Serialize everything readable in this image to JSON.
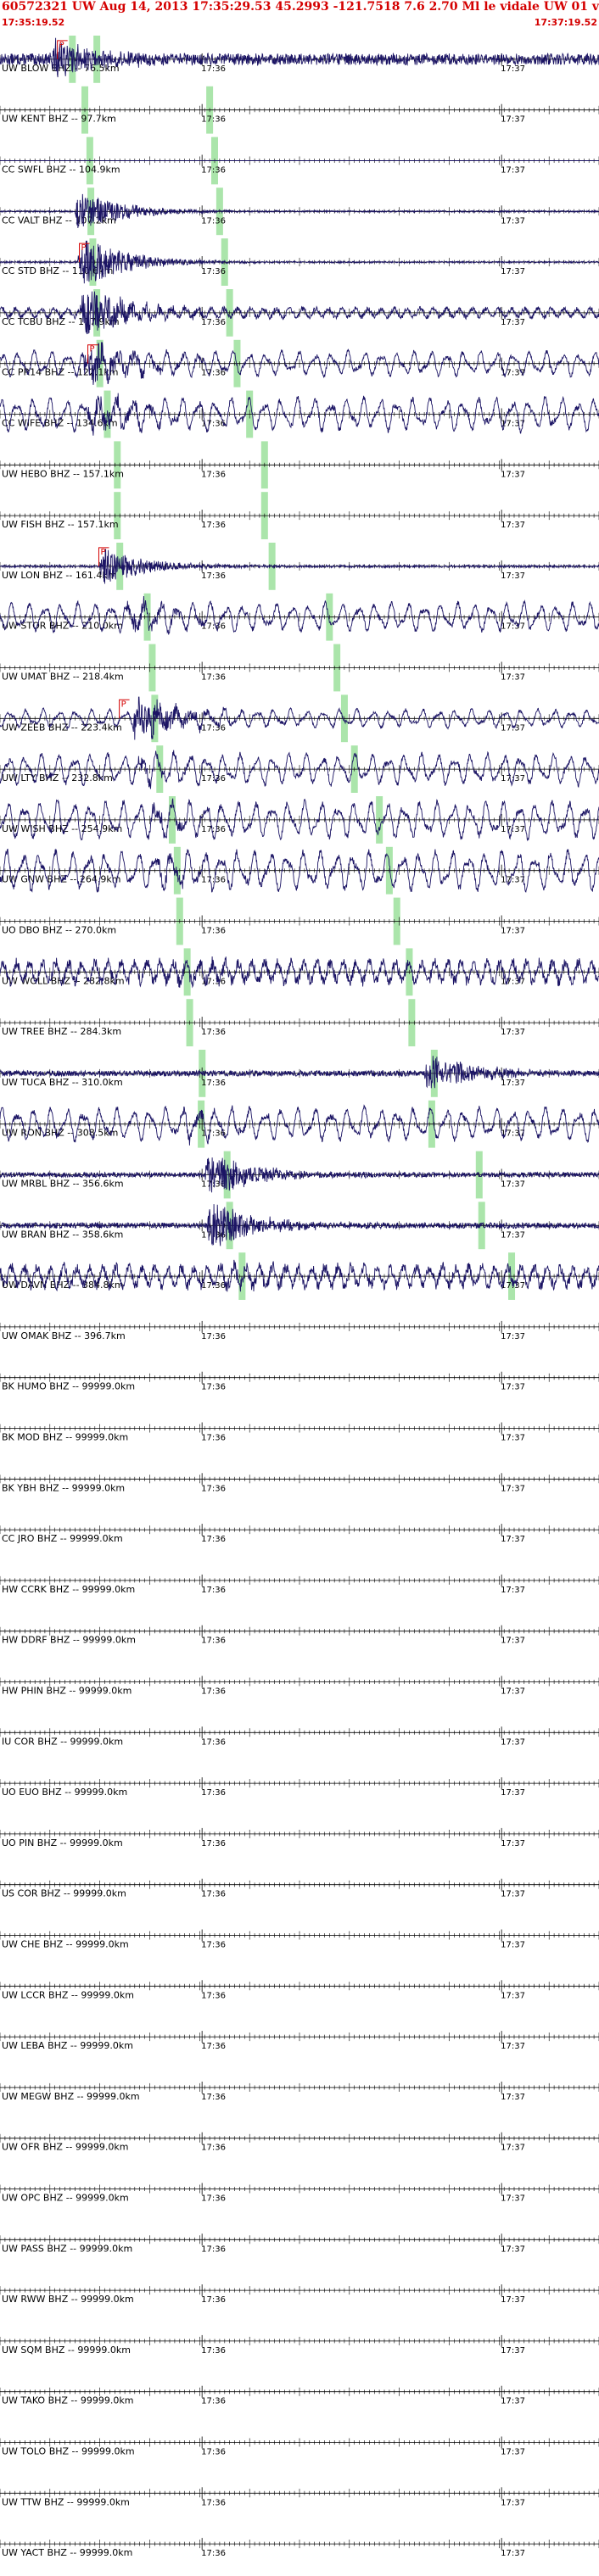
{
  "header": {
    "title": "60572321 UW Aug 14, 2013 17:35:29.53   45.2993 -121.7518  7.6 2.70 Ml le vidale UW 01  v",
    "start_time": "17:35:19.52",
    "end_time": "17:37:19.52"
  },
  "chart_data": {
    "type": "seismogram",
    "title": "60572321 UW Aug 14, 2013 17:35:29.53   45.2993 -121.7518  7.6 2.70 Ml le vidale UW 01  v",
    "time_window": {
      "start": "17:35:19.52",
      "end": "17:37:19.52",
      "duration_s": 120
    },
    "minute_marks": [
      {
        "label": "17:36",
        "t_s": 40.48
      },
      {
        "label": "17:37",
        "t_s": 100.48
      }
    ],
    "tick_interval_s": 1,
    "picks": [
      {
        "label": "P",
        "color": "#d40000"
      }
    ],
    "traces": [
      {
        "label": "UW BLOW BHZ -- 76.5km",
        "amp": 0.7,
        "burst_t": 10.0,
        "burst_amp": 0.55,
        "noise": "hf",
        "pick_t": 11.5,
        "p_t": 14.5,
        "s_t": 19.4
      },
      {
        "label": "UW KENT BHZ -- 97.7km",
        "amp": 0.0,
        "burst_t": 13.5,
        "burst_amp": 0.0,
        "noise": "flat",
        "p_t": 17.0,
        "s_t": 42.0
      },
      {
        "label": "CC SWFL BHZ -- 104.9km",
        "amp": 0.05,
        "burst_t": 14.8,
        "burst_amp": 0.0,
        "noise": "flat",
        "p_t": 18.0,
        "s_t": 43.0
      },
      {
        "label": "CC VALT BHZ -- 107.2km",
        "amp": 0.1,
        "burst_t": 15.0,
        "burst_amp": 0.6,
        "noise": "hf",
        "p_t": 18.2,
        "s_t": 44.0
      },
      {
        "label": "CC STD BHZ -- 110.6km",
        "amp": 0.1,
        "burst_t": 15.5,
        "burst_amp": 0.8,
        "noise": "hf",
        "pick_t": 15.9,
        "p_t": 18.6,
        "s_t": 45.0
      },
      {
        "label": "CC TCBU BHZ -- 117.9km",
        "amp": 0.4,
        "burst_t": 16.0,
        "burst_amp": 0.7,
        "noise": "mixed",
        "p_t": 19.4,
        "s_t": 46.0
      },
      {
        "label": "CC PR14 BHZ -- 122.1km",
        "amp": 0.6,
        "burst_t": 16.5,
        "burst_amp": 0.6,
        "noise": "lf",
        "pick_t": 17.6,
        "p_t": 20.0,
        "s_t": 47.5
      },
      {
        "label": "CC WIFE BHZ -- 134.6km",
        "amp": 0.8,
        "burst_t": 17.5,
        "burst_amp": 0.4,
        "noise": "lf",
        "p_t": 21.5,
        "s_t": 50.0
      },
      {
        "label": "UW HEBO BHZ -- 157.1km",
        "amp": 0.0,
        "burst_t": 19.5,
        "burst_amp": 0.0,
        "noise": "flat",
        "p_t": 23.5,
        "s_t": 53.0
      },
      {
        "label": "UW FISH BHZ -- 157.1km",
        "amp": 0.0,
        "burst_t": 19.5,
        "burst_amp": 0.0,
        "noise": "flat",
        "p_t": 23.5,
        "s_t": 53.0
      },
      {
        "label": "UW LON BHZ -- 161.4km",
        "amp": 0.15,
        "burst_t": 20.0,
        "burst_amp": 0.55,
        "noise": "hf",
        "pick_t": 19.8,
        "p_t": 24.0,
        "s_t": 54.5
      },
      {
        "label": "UW STOR BHZ -- 210.0km",
        "amp": 0.7,
        "burst_t": 25.0,
        "burst_amp": 0.3,
        "noise": "lf",
        "p_t": 29.5,
        "s_t": 66.0
      },
      {
        "label": "UW UMAT BHZ -- 218.4km",
        "amp": 0.0,
        "burst_t": 26.0,
        "burst_amp": 0.0,
        "noise": "flat",
        "p_t": 30.5,
        "s_t": 67.5
      },
      {
        "label": "UW ZEEB BHZ -- 223.4km",
        "amp": 0.45,
        "burst_t": 26.5,
        "burst_amp": 0.6,
        "noise": "lf",
        "pick_t": 23.9,
        "p_t": 31.0,
        "s_t": 69.0
      },
      {
        "label": "UW LTY BHZ -- 232.8km",
        "amp": 0.75,
        "burst_t": 27.5,
        "burst_amp": 0.2,
        "noise": "lf",
        "p_t": 32.0,
        "s_t": 71.0
      },
      {
        "label": "UW WISH BHZ -- 254.9km",
        "amp": 0.9,
        "burst_t": 30.0,
        "burst_amp": 0.2,
        "noise": "lf",
        "p_t": 34.5,
        "s_t": 76.0
      },
      {
        "label": "UW GNW BHZ -- 264.9km",
        "amp": 0.95,
        "burst_t": 31.0,
        "burst_amp": 0.2,
        "noise": "lf",
        "p_t": 35.5,
        "s_t": 78.0
      },
      {
        "label": "UO DBO BHZ -- 270.0km",
        "amp": 0.0,
        "burst_t": 31.5,
        "burst_amp": 0.0,
        "noise": "flat",
        "p_t": 36.0,
        "s_t": 79.5
      },
      {
        "label": "UW WOLL BHZ -- 282.8km",
        "amp": 0.9,
        "burst_t": 33.0,
        "burst_amp": 0.2,
        "noise": "mixed",
        "p_t": 37.5,
        "s_t": 82.0
      },
      {
        "label": "UW TREE BHZ -- 284.3km",
        "amp": 0.0,
        "burst_t": 33.0,
        "burst_amp": 0.0,
        "noise": "flat",
        "p_t": 38.0,
        "s_t": 82.5
      },
      {
        "label": "UW TUCA BHZ -- 310.0km",
        "amp": 0.35,
        "burst_t": 85.0,
        "burst_amp": 0.6,
        "noise": "hf",
        "p_t": 40.5,
        "s_t": 87.0
      },
      {
        "label": "UW RON BHZ -- 308.5km",
        "amp": 0.8,
        "burst_t": 36.0,
        "burst_amp": 0.2,
        "noise": "lf",
        "p_t": 40.3,
        "s_t": 86.5
      },
      {
        "label": "UW MRBL BHZ -- 356.6km",
        "amp": 0.3,
        "burst_t": 41.0,
        "burst_amp": 0.7,
        "noise": "hf",
        "p_t": 45.5,
        "s_t": 96.0
      },
      {
        "label": "UW BRAN BHZ -- 358.6km",
        "amp": 0.35,
        "burst_t": 41.5,
        "burst_amp": 0.7,
        "noise": "hf",
        "p_t": 46.0,
        "s_t": 96.5
      },
      {
        "label": "UW DAVN BHZ -- 384.8km",
        "amp": 0.9,
        "burst_t": 44.0,
        "burst_amp": 0.2,
        "noise": "mixed",
        "p_t": 48.5,
        "s_t": 102.5
      },
      {
        "label": "UW OMAK BHZ -- 396.7km",
        "amp": 0.0,
        "burst_t": 45.0,
        "burst_amp": 0.0,
        "noise": "flat"
      },
      {
        "label": "BK HUMO BHZ -- 99999.0km",
        "amp": 0.0,
        "noise": "flat"
      },
      {
        "label": "BK MOD BHZ -- 99999.0km",
        "amp": 0.0,
        "noise": "flat"
      },
      {
        "label": "BK YBH BHZ -- 99999.0km",
        "amp": 0.0,
        "noise": "flat"
      },
      {
        "label": "CC JRO BHZ -- 99999.0km",
        "amp": 0.0,
        "noise": "flat"
      },
      {
        "label": "HW CCRK BHZ -- 99999.0km",
        "amp": 0.0,
        "noise": "flat"
      },
      {
        "label": "HW DDRF BHZ -- 99999.0km",
        "amp": 0.0,
        "noise": "flat"
      },
      {
        "label": "HW PHIN BHZ -- 99999.0km",
        "amp": 0.0,
        "noise": "flat"
      },
      {
        "label": "IU COR BHZ -- 99999.0km",
        "amp": 0.0,
        "noise": "flat"
      },
      {
        "label": "UO EUO BHZ -- 99999.0km",
        "amp": 0.0,
        "noise": "flat"
      },
      {
        "label": "UO PIN BHZ -- 99999.0km",
        "amp": 0.0,
        "noise": "flat"
      },
      {
        "label": "US COR BHZ -- 99999.0km",
        "amp": 0.0,
        "noise": "flat"
      },
      {
        "label": "UW CHE BHZ -- 99999.0km",
        "amp": 0.0,
        "noise": "flat"
      },
      {
        "label": "UW LCCR BHZ -- 99999.0km",
        "amp": 0.0,
        "noise": "flat"
      },
      {
        "label": "UW LEBA BHZ -- 99999.0km",
        "amp": 0.0,
        "noise": "flat"
      },
      {
        "label": "UW MEGW BHZ -- 99999.0km",
        "amp": 0.0,
        "noise": "flat"
      },
      {
        "label": "UW OFR BHZ -- 99999.0km",
        "amp": 0.0,
        "noise": "flat"
      },
      {
        "label": "UW OPC BHZ -- 99999.0km",
        "amp": 0.0,
        "noise": "flat"
      },
      {
        "label": "UW PASS BHZ -- 99999.0km",
        "amp": 0.0,
        "noise": "flat"
      },
      {
        "label": "UW RWW BHZ -- 99999.0km",
        "amp": 0.0,
        "noise": "flat"
      },
      {
        "label": "UW SQM BHZ -- 99999.0km",
        "amp": 0.0,
        "noise": "flat"
      },
      {
        "label": "UW TAKO BHZ -- 99999.0km",
        "amp": 0.0,
        "noise": "flat"
      },
      {
        "label": "UW TOLO BHZ -- 99999.0km",
        "amp": 0.0,
        "noise": "flat"
      },
      {
        "label": "UW TTW BHZ -- 99999.0km",
        "amp": 0.0,
        "noise": "flat"
      },
      {
        "label": "UW YACT BHZ -- 99999.0km",
        "amp": 0.0,
        "noise": "flat"
      }
    ],
    "colors": {
      "trace": "#1b1464",
      "title": "#d40000",
      "phase_marker": "#8fdc8f",
      "pick": "#d40000",
      "axis": "#000000"
    }
  }
}
